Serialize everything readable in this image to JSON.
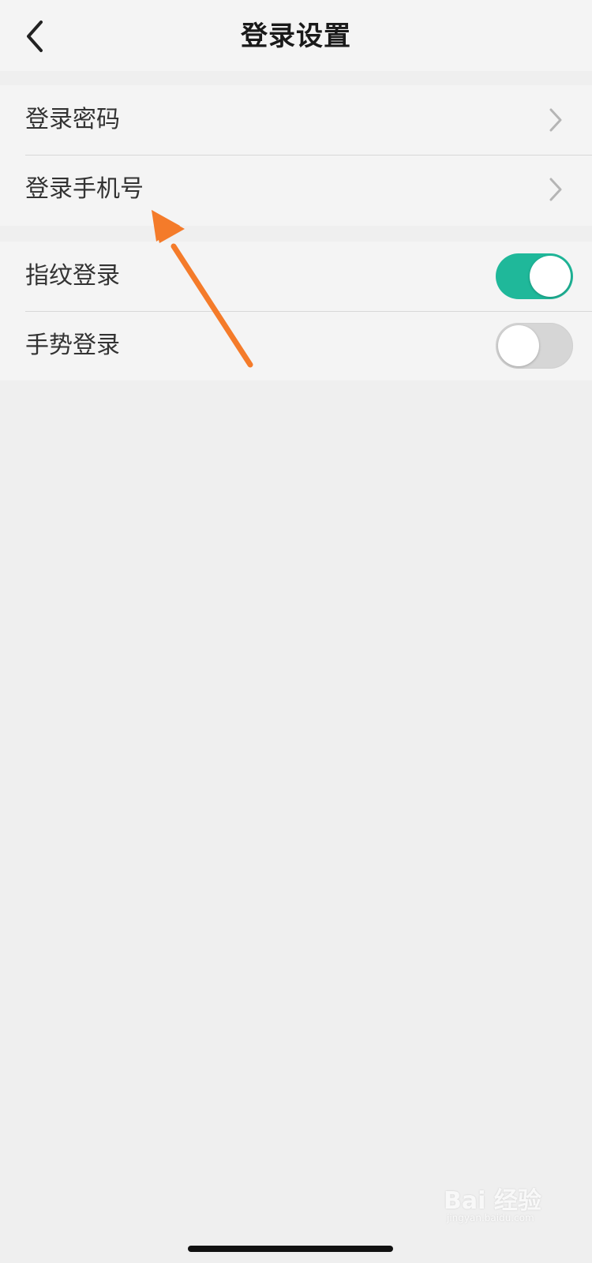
{
  "nav": {
    "back_icon": "chevron-left-icon",
    "title": "登录设置"
  },
  "settings": {
    "group1": [
      {
        "label": "登录密码",
        "icon": "chevron-right-icon"
      },
      {
        "label": "登录手机号",
        "icon": "chevron-right-icon"
      }
    ],
    "group2": [
      {
        "label": "指纹登录",
        "toggle": "on"
      },
      {
        "label": "手势登录",
        "toggle": "off"
      }
    ]
  },
  "colors": {
    "toggle_on": "#1fb89a",
    "toggle_off": "#d6d6d6",
    "annotation_arrow": "#f47b2a"
  },
  "watermark": {
    "text": "Bai 经验",
    "sub": "jingyan.baidu.com"
  }
}
